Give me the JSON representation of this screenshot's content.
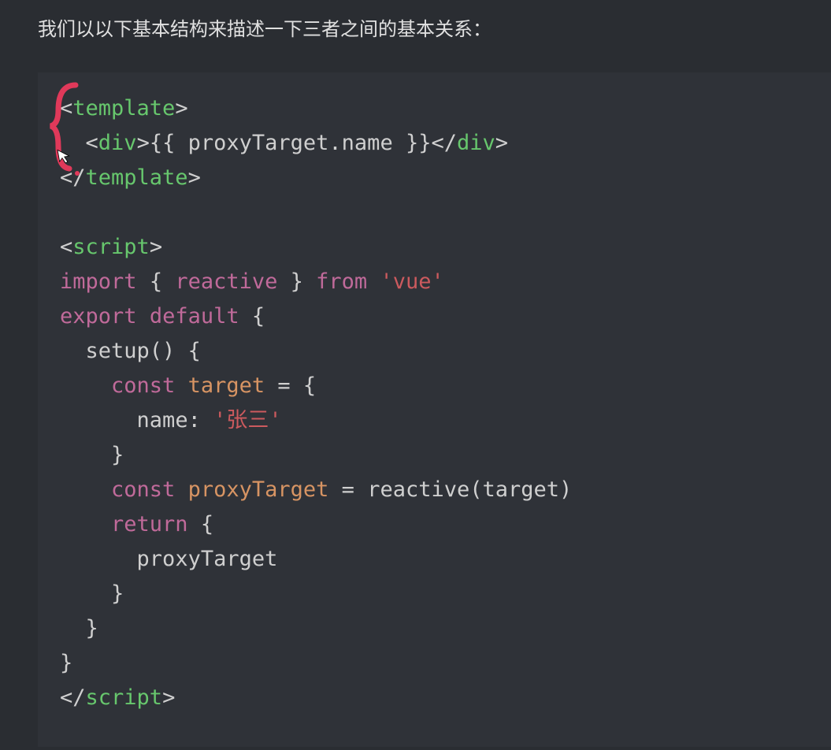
{
  "intro_text": "我们以以下基本结构来描述一下三者之间的基本关系：",
  "code": {
    "l1_open_angle": "<",
    "l1_tag_template": "template",
    "l1_close_angle": ">",
    "l2_indent": "  ",
    "l2_open_angle": "<",
    "l2_tag_div": "div",
    "l2_close_angle": ">",
    "l2_mustache_open": "{{ ",
    "l2_expr": "proxyTarget.name",
    "l2_mustache_close": " }}",
    "l2_open_close_angle": "</",
    "l2_tag_div2": "div",
    "l2_close_angle2": ">",
    "l3_open_close_angle": "</",
    "l3_tag_template": "template",
    "l3_close_angle": ">",
    "l5_open_angle": "<",
    "l5_tag_script": "script",
    "l5_close_angle": ">",
    "l6_kw_import": "import",
    "l6_sp1": " ",
    "l6_brace_open": "{ ",
    "l6_reactive": "reactive",
    "l6_brace_close": " }",
    "l6_sp2": " ",
    "l6_kw_from": "from",
    "l6_sp3": " ",
    "l6_str_vue": "'vue'",
    "l7_kw_export": "export",
    "l7_sp1": " ",
    "l7_kw_default": "default",
    "l7_sp2": " ",
    "l7_brace": "{",
    "l8_indent": "  ",
    "l8_setup": "setup",
    "l8_paren": "()",
    "l8_sp": " ",
    "l8_brace": "{",
    "l9_indent": "    ",
    "l9_kw_const": "const",
    "l9_sp1": " ",
    "l9_target": "target",
    "l9_sp2": " ",
    "l9_eq": "=",
    "l9_sp3": " ",
    "l9_brace": "{",
    "l10_indent": "      ",
    "l10_name": "name",
    "l10_colon": ": ",
    "l10_str": "'张三'",
    "l11_indent": "    ",
    "l11_brace": "}",
    "l12_indent": "    ",
    "l12_kw_const": "const",
    "l12_sp1": " ",
    "l12_proxyTarget": "proxyTarget",
    "l12_sp2": " ",
    "l12_eq": "=",
    "l12_sp3": " ",
    "l12_call": "reactive",
    "l12_paren_open": "(",
    "l12_arg": "target",
    "l12_paren_close": ")",
    "l13_indent": "    ",
    "l13_kw_return": "return",
    "l13_sp": " ",
    "l13_brace": "{",
    "l14_indent": "      ",
    "l14_proxyTarget": "proxyTarget",
    "l15_indent": "    ",
    "l15_brace": "}",
    "l16_indent": "  ",
    "l16_brace": "}",
    "l17_brace": "}",
    "l18_open_close_angle": "</",
    "l18_tag_script": "script",
    "l18_close_angle": ">"
  }
}
